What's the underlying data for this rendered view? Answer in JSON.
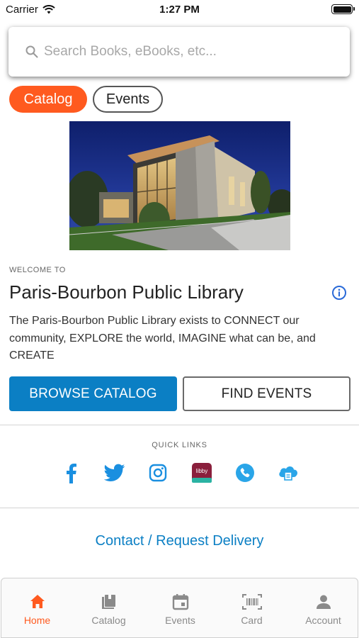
{
  "status_bar": {
    "carrier": "Carrier",
    "time": "1:27 PM"
  },
  "search": {
    "placeholder": "Search Books, eBooks, etc..."
  },
  "tabs_top": [
    {
      "label": "Catalog",
      "active": true
    },
    {
      "label": "Events",
      "active": false
    }
  ],
  "welcome": {
    "eyebrow": "WELCOME TO",
    "title": "Paris-Bourbon Public Library",
    "description": "The Paris-Bourbon Public Library exists to CONNECT our community, EXPLORE the world, IMAGINE what can be, and CREATE"
  },
  "actions": {
    "browse_label": "BROWSE CATALOG",
    "events_label": "FIND EVENTS"
  },
  "quick_links": {
    "label": "QUICK LINKS",
    "items": [
      "facebook-icon",
      "twitter-icon",
      "instagram-icon",
      "libby-icon",
      "phone-icon",
      "cloud-print-icon"
    ],
    "libby_text": "libby"
  },
  "contact_link": "Contact / Request Delivery",
  "bottom_nav": [
    {
      "label": "Home",
      "icon": "home-icon",
      "active": true
    },
    {
      "label": "Catalog",
      "icon": "books-icon",
      "active": false
    },
    {
      "label": "Events",
      "icon": "calendar-icon",
      "active": false
    },
    {
      "label": "Card",
      "icon": "barcode-icon",
      "active": false
    },
    {
      "label": "Account",
      "icon": "person-icon",
      "active": false
    }
  ],
  "colors": {
    "accent": "#ff5a1f",
    "primary": "#0b7fc4",
    "social_blue": "#1a8fe0"
  }
}
